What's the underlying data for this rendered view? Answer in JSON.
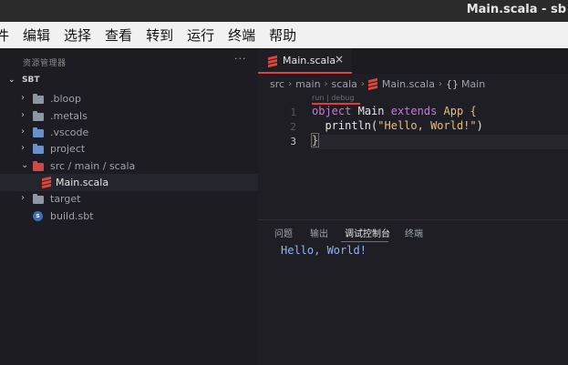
{
  "window": {
    "title": "Main.scala - sb"
  },
  "menu": [
    "件",
    "编辑",
    "选择",
    "查看",
    "转到",
    "运行",
    "终端",
    "帮助"
  ],
  "sidebar": {
    "header": "资源管理器",
    "more": "···",
    "section": "SBT",
    "items": [
      {
        "label": ".bloop",
        "icon": "folder-icon"
      },
      {
        "label": ".metals",
        "icon": "folder-icon"
      },
      {
        "label": ".vscode",
        "icon": "vscode-folder-icon"
      },
      {
        "label": "project",
        "icon": "project-folder-icon"
      },
      {
        "label": "src / main / scala",
        "icon": "scala-folder-icon"
      },
      {
        "label": "Main.scala",
        "icon": "scala-file-icon"
      },
      {
        "label": "target",
        "icon": "folder-icon"
      },
      {
        "label": "build.sbt",
        "icon": "sbt-file-icon"
      }
    ]
  },
  "editor": {
    "tab": {
      "label": "Main.scala",
      "close": "×"
    },
    "breadcrumb": [
      "src",
      "main",
      "scala",
      "Main.scala",
      "Main"
    ],
    "codelens": "run | debug",
    "line_numbers": [
      "1",
      "2",
      "3"
    ],
    "code": {
      "l1_kw": "object",
      "l1_name": "Main",
      "l1_extends": "extends",
      "l1_type": "App",
      "l1_brace": "{",
      "l2_indent": "  ",
      "l2_fn": "println",
      "l2_open": "(",
      "l2_str": "\"Hello, World!\"",
      "l2_close": ")",
      "l3_brace": "}"
    }
  },
  "panel": {
    "tabs": [
      "问题",
      "输出",
      "调试控制台",
      "终端"
    ],
    "active_tab": "调试控制台",
    "output": "Hello, World!"
  }
}
